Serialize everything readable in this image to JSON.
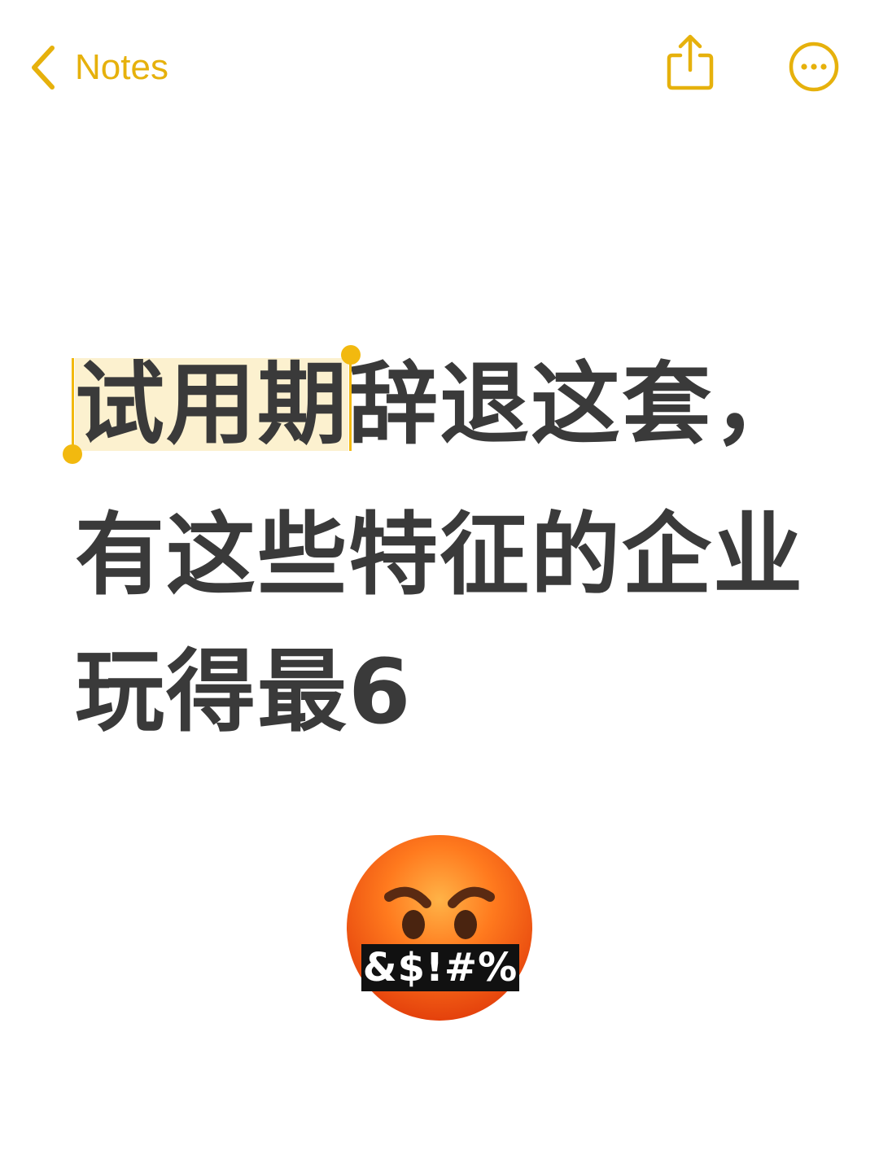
{
  "nav": {
    "back_label": "Notes",
    "back_icon": "chevron-left-icon",
    "share_icon": "share-icon",
    "more_icon": "ellipsis-circle-icon"
  },
  "accent_color": "#e6b10c",
  "note": {
    "line1_selected": "试用期",
    "line1_rest": "辞退这套，",
    "line2": "有这些特征的企业",
    "line3": "玩得最6"
  },
  "emoji": {
    "name": "face-with-symbols-on-mouth",
    "symbols": "&$!#%"
  }
}
